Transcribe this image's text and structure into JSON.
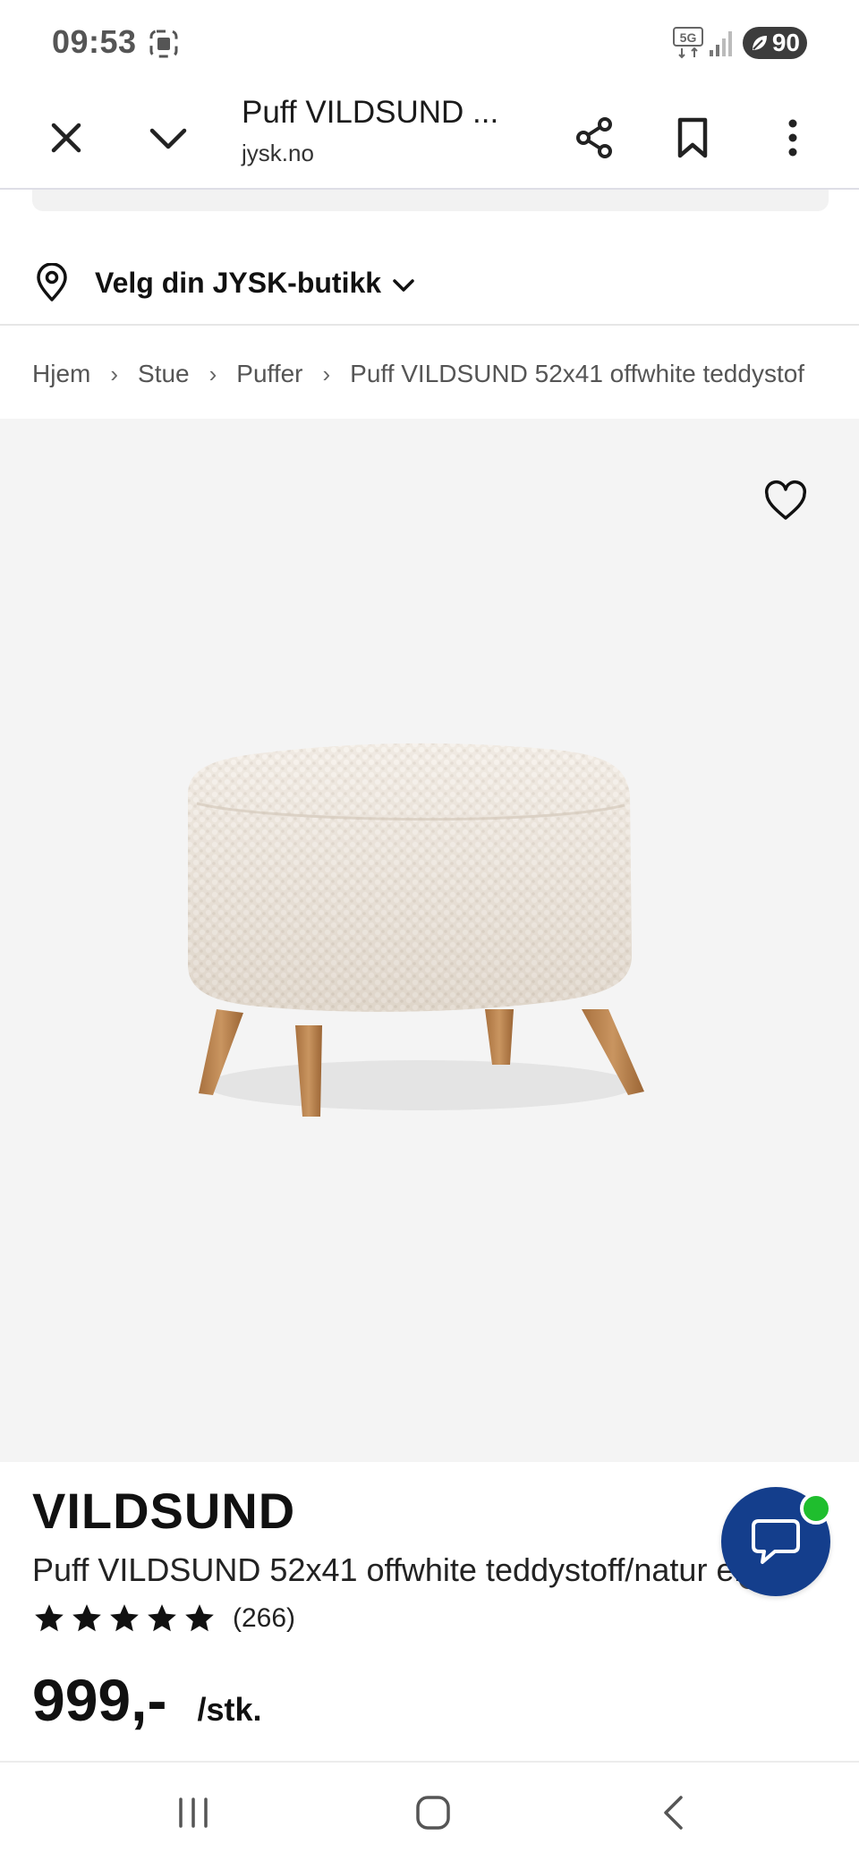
{
  "status_bar": {
    "time": "09:53",
    "network": "5G",
    "battery": "90",
    "icons": [
      "screenshot-icon",
      "5g-icon",
      "signal-icon",
      "battery-icon"
    ]
  },
  "tab_bar": {
    "title": "Puff VILDSUND ...",
    "url": "jysk.no",
    "icons": [
      "close-icon",
      "chevron-down-icon",
      "share-icon",
      "bookmark-icon",
      "more-vert-icon"
    ]
  },
  "store": {
    "label": "Velg din JYSK-butikk",
    "icon": "location-pin-icon"
  },
  "breadcrumb": {
    "items": [
      "Hjem",
      "Stue",
      "Puffer",
      "Puff VILDSUND 52x41 offwhite teddystof"
    ],
    "separator": "›"
  },
  "gallery": {
    "image_count": 2,
    "current_index": 1
  },
  "product": {
    "brand": "VILDSUND",
    "title": "Puff VILDSUND 52x41 offwhite teddystoff/natur eik",
    "rating_stars": 5,
    "review_count": "(266)",
    "price": "999,-",
    "unit": "/stk."
  },
  "colors": {
    "accent": "#143e8c",
    "online": "#1fbe2e",
    "image_bg": "#f4f4f4"
  }
}
